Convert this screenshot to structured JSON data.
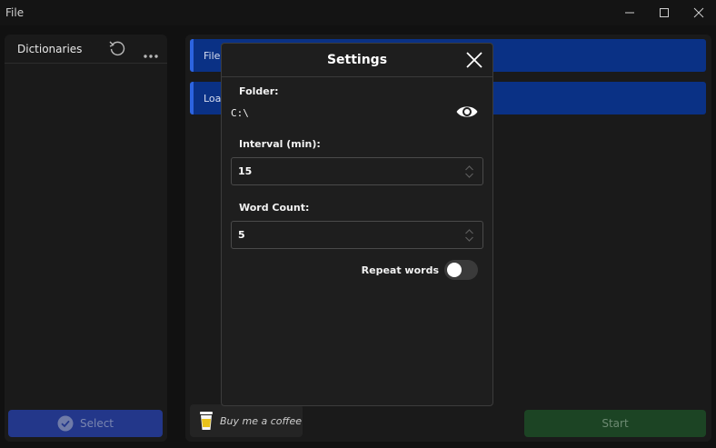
{
  "window": {
    "title": "File",
    "minimize_icon": "minimize-icon",
    "maximize_icon": "maximize-icon",
    "close_icon": "close-icon"
  },
  "sidebar": {
    "title": "Dictionaries",
    "refresh_icon": "refresh-icon",
    "more_icon": "more-icon",
    "select_label": "Select",
    "select_icon": "check-circle-icon"
  },
  "main": {
    "file_bar_label": "File",
    "load_bar_label": "Loa",
    "coffee_label": "Buy me a coffee",
    "coffee_icon": "coffee-cup-icon",
    "start_label": "Start"
  },
  "settings": {
    "title": "Settings",
    "folder_label": "Folder:",
    "folder_value": "C:\\",
    "interval_label": "Interval (min):",
    "interval_value": "15",
    "word_count_label": "Word Count:",
    "word_count_value": "5",
    "repeat_label": "Repeat words",
    "repeat_enabled": false
  },
  "colors": {
    "accent_blue": "#0a3185",
    "select_button": "#23378a",
    "start_button": "#1c4424"
  }
}
